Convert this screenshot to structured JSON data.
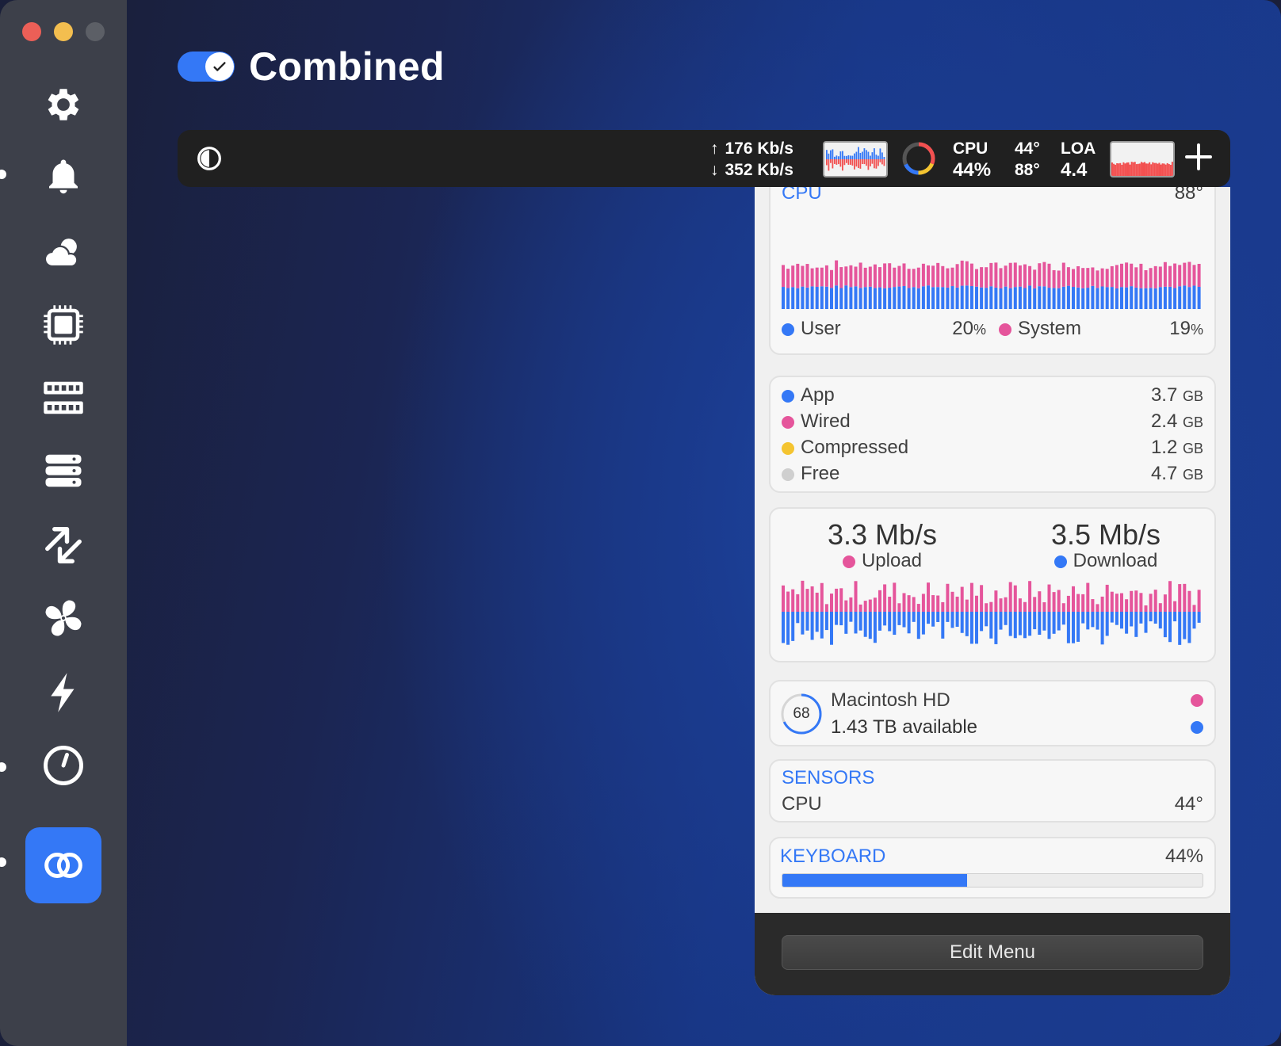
{
  "window": {
    "title": "Combined",
    "enabled": true
  },
  "sidebar": {
    "items": [
      {
        "icon": "gear-icon"
      },
      {
        "icon": "bell-icon"
      },
      {
        "icon": "cloud-sun-icon"
      },
      {
        "icon": "cpu-chip-icon"
      },
      {
        "icon": "memory-icon"
      },
      {
        "icon": "disk-stack-icon"
      },
      {
        "icon": "network-arrows-icon"
      },
      {
        "icon": "fan-icon"
      },
      {
        "icon": "bolt-icon"
      },
      {
        "icon": "clock-icon"
      },
      {
        "icon": "combined-rings-icon",
        "active": true
      }
    ]
  },
  "menubar": {
    "upload": "176 Kb/s",
    "download": "352 Kb/s",
    "cpu_label": "CPU",
    "cpu_value": "44%",
    "temp_top": "44°",
    "temp_bottom": "88°",
    "load_label": "LOA",
    "load_value": "4.4"
  },
  "cpu_card": {
    "title": "CPU",
    "temp": "88°",
    "user_label": "User",
    "user_value": "20",
    "system_label": "System",
    "system_value": "19",
    "percent_unit": "%"
  },
  "memory_card": {
    "rows": [
      {
        "label": "App",
        "value": "3.7",
        "unit": "GB",
        "color": "#3478f6"
      },
      {
        "label": "Wired",
        "value": "2.4",
        "unit": "GB",
        "color": "#e5559b"
      },
      {
        "label": "Compressed",
        "value": "1.2",
        "unit": "GB",
        "color": "#f4c430"
      },
      {
        "label": "Free",
        "value": "4.7",
        "unit": "GB",
        "color": "#cfcfcf"
      }
    ]
  },
  "network_card": {
    "upload_value": "3.3 Mb/s",
    "upload_label": "Upload",
    "download_value": "3.5 Mb/s",
    "download_label": "Download"
  },
  "disk_card": {
    "percent": "68",
    "name": "Macintosh HD",
    "available": "1.43 TB available"
  },
  "sensors_card": {
    "title": "SENSORS",
    "label": "CPU",
    "value": "44°"
  },
  "keyboard_card": {
    "title": "KEYBOARD",
    "value": "44%",
    "level": 0.44
  },
  "footer": {
    "edit_label": "Edit Menu"
  },
  "colors": {
    "accent": "#3478f6",
    "pink": "#e5559b",
    "yellow": "#f4c430",
    "red": "#f25050"
  }
}
